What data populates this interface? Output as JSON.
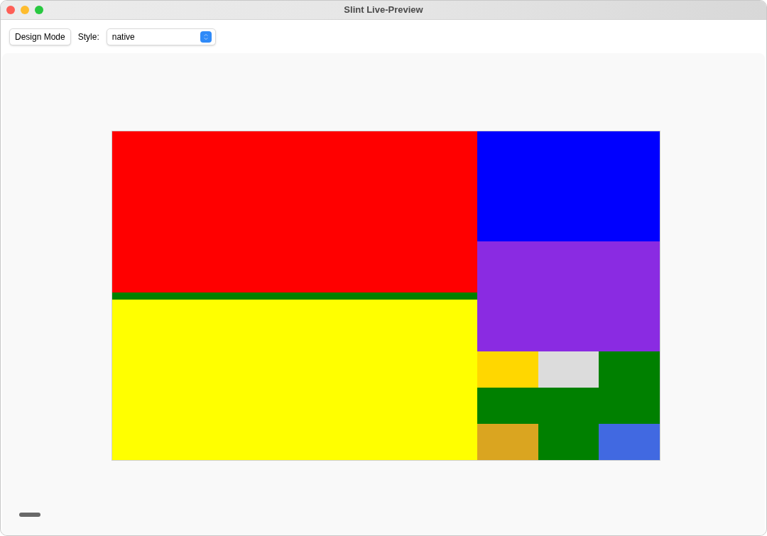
{
  "window": {
    "title": "Slint Live-Preview"
  },
  "toolbar": {
    "design_mode_button": "Design Mode",
    "style_label": "Style:",
    "style_combo": {
      "value": "native"
    }
  },
  "preview": {
    "left_column": [
      {
        "color": "#ff0000"
      },
      {
        "color": "#008000"
      },
      {
        "color": "#ffff00"
      }
    ],
    "right_column": [
      {
        "color": "#0000ff"
      },
      {
        "color": "#8a2be2"
      }
    ],
    "grid": [
      {
        "color": "#ffd700"
      },
      {
        "color": "#dcdcdc"
      },
      {
        "color": "#008000"
      },
      {
        "color": "#008000"
      },
      {
        "color": "#008000"
      },
      {
        "color": "#008000"
      },
      {
        "color": "#daa520"
      },
      {
        "color": "#008000"
      },
      {
        "color": "#4169e1"
      }
    ]
  }
}
